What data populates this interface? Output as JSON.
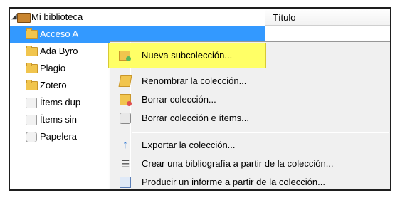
{
  "tree": {
    "root_label": "Mi biblioteca",
    "items": [
      {
        "label": "Acceso A",
        "icon": "folder-icon",
        "selected": true
      },
      {
        "label": "Ada Byro",
        "icon": "folder-icon"
      },
      {
        "label": "Plagio",
        "icon": "folder-icon"
      },
      {
        "label": "Zotero",
        "icon": "folder-icon"
      },
      {
        "label": "Ítems dup",
        "icon": "duplicate-items-icon"
      },
      {
        "label": "Ítems sin",
        "icon": "unfiled-items-icon"
      },
      {
        "label": "Papelera",
        "icon": "trash-icon"
      }
    ]
  },
  "header": {
    "title_column": "Título"
  },
  "context_menu": {
    "items": [
      {
        "label": "Nueva subcolección...",
        "icon": "new-subcollection-icon",
        "highlighted": true
      },
      {
        "label": "Renombrar la colección...",
        "icon": "rename-icon"
      },
      {
        "label": "Borrar colección...",
        "icon": "delete-collection-icon"
      },
      {
        "label": "Borrar colección e ítems...",
        "icon": "delete-items-icon"
      },
      {
        "label": "Exportar la colección...",
        "icon": "export-icon"
      },
      {
        "label": "Crear una bibliografía a partir de la colección...",
        "icon": "bibliography-icon"
      },
      {
        "label": "Producir un informe a partir de la colección...",
        "icon": "report-icon"
      }
    ]
  },
  "colors": {
    "selection": "#3399ff",
    "highlight": "#ffff66",
    "folder": "#f1c54e"
  }
}
